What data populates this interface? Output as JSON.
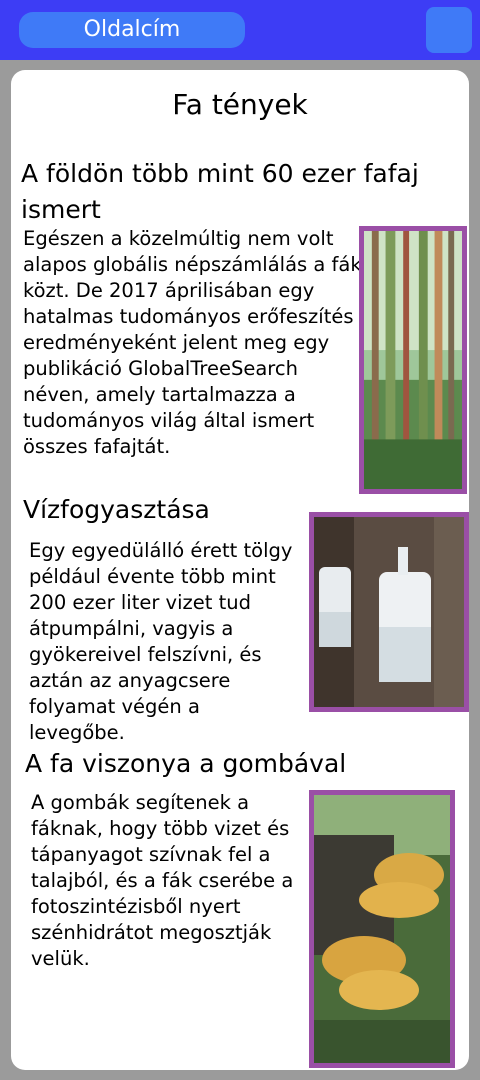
{
  "header": {
    "title": "Oldalcím",
    "menu_icon": "menu-icon"
  },
  "page": {
    "title": "Fa tények"
  },
  "colors": {
    "topbar": "#3d3df5",
    "pill": "#3f7af7",
    "image_border": "#9a4fa6",
    "background": "#9b9b9b"
  },
  "sections": [
    {
      "heading": "A földön több mint 60 ezer fafaj ismert",
      "text": "Egészen a közelmúltig nem volt alapos globális népszámlálás a fák közt. De 2017 áprilisában egy hatalmas tudományos erőfeszítés eredményeként jelent meg egy publikáció GlobalTreeSearch néven, amely tartalmazza a tudományos világ által ismert összes fafajtát.",
      "image": "tree-trunks-image"
    },
    {
      "heading": "Vízfogyasztása",
      "text": "Egy egyedülálló érett tölgy például évente több mint 200 ezer liter vizet tud átpumpálni, vagyis a gyökereivel felszívni, és aztán az anyagcsere folyamat végén a levegőbe.",
      "image": "sap-jugs-image"
    },
    {
      "heading": "A fa viszonya a gombával",
      "text": "A gombák segítenek a fáknak, hogy több vizet és tápanyagot szívnak fel a talajból, és a fák cserébe a fotoszintézisből nyert szénhidrátot megosztják velük.",
      "image": "mushrooms-image"
    }
  ]
}
